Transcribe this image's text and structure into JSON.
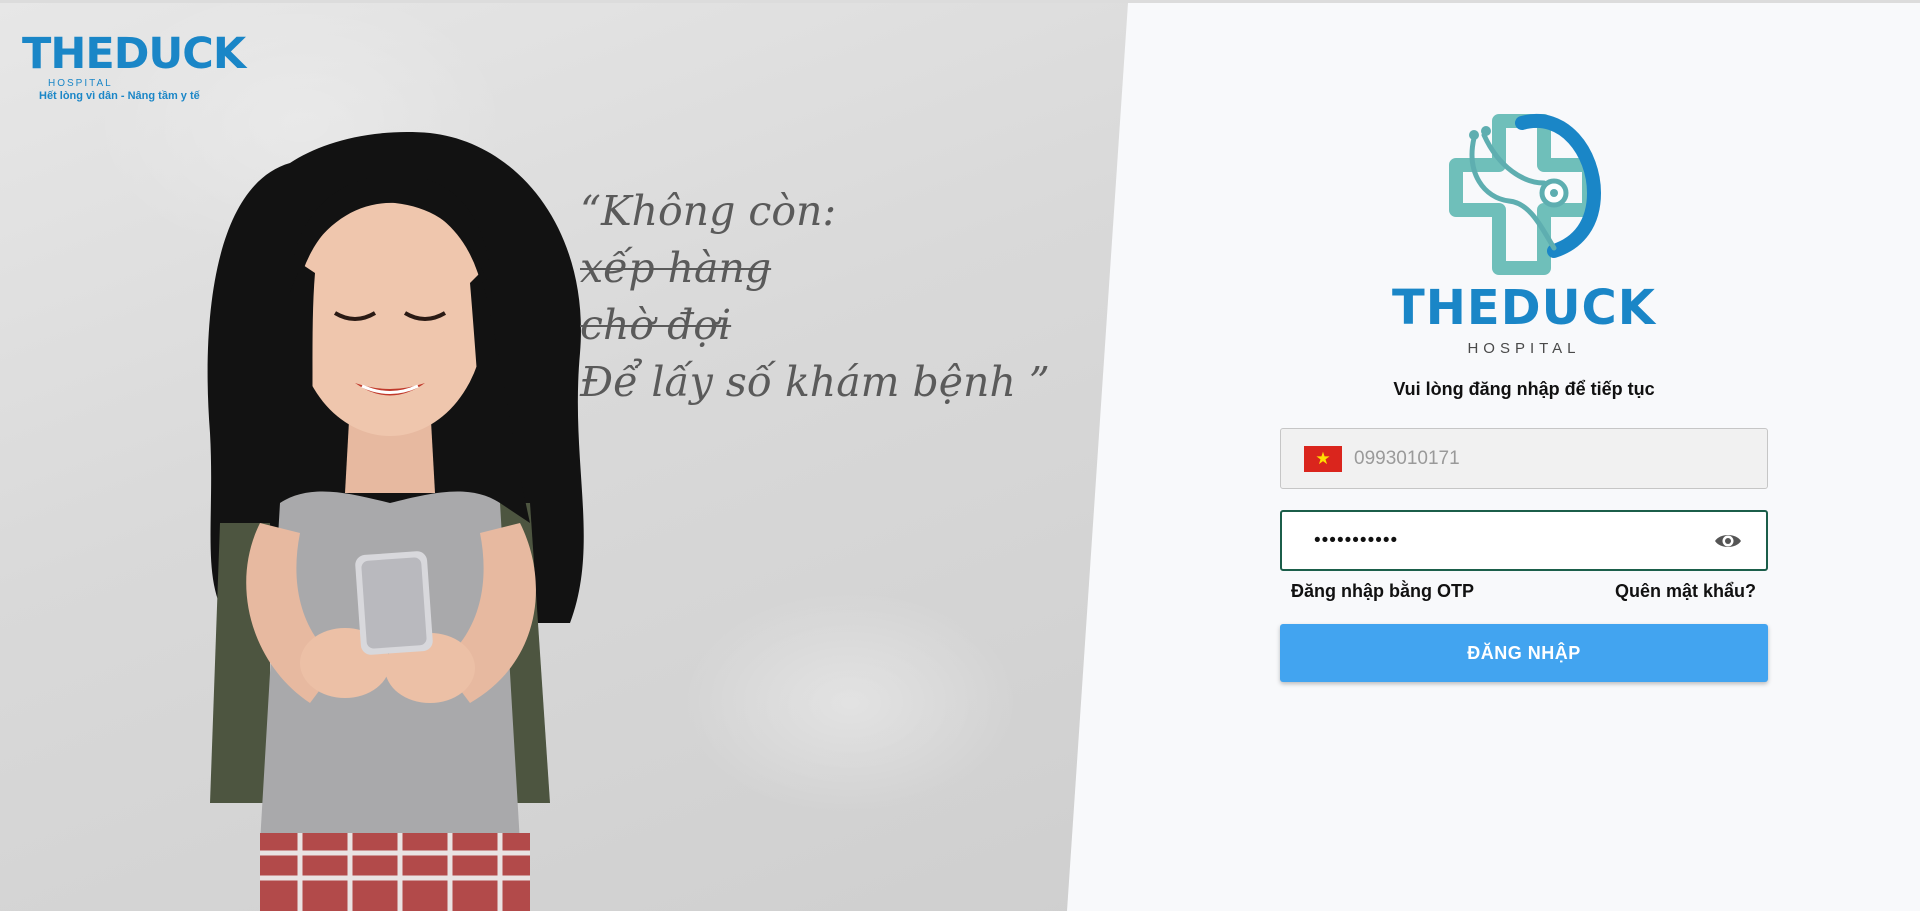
{
  "brand": {
    "name": "THEDUCK",
    "subtitle": "HOSPITAL",
    "tagline": "Hết lòng vì dân - Nâng tầm y tế",
    "color": "#1a86c7",
    "accent": "#6fbfba"
  },
  "hero": {
    "quote_lines": [
      {
        "text": "“Không còn:",
        "strike": false
      },
      {
        "text": "xếp hàng",
        "strike": true
      },
      {
        "text": "chờ đợi",
        "strike": true
      },
      {
        "text": "Để lấy số khám bệnh ”",
        "strike": false
      }
    ],
    "image": "smiling-woman-using-phone"
  },
  "login": {
    "prompt": "Vui lòng đăng nhập để tiếp tục",
    "phone": {
      "value": "0993010171",
      "country_flag": "vietnam-flag-icon"
    },
    "password": {
      "masked_value": "•••••••••••",
      "toggle_icon": "eye-icon"
    },
    "otp_link": "Đăng nhập bằng OTP",
    "forgot_link": "Quên mật khẩu?",
    "submit_label": "ĐĂNG NHẬP",
    "submit_color": "#42a4f0",
    "focus_border_color": "#1b5e4a"
  }
}
